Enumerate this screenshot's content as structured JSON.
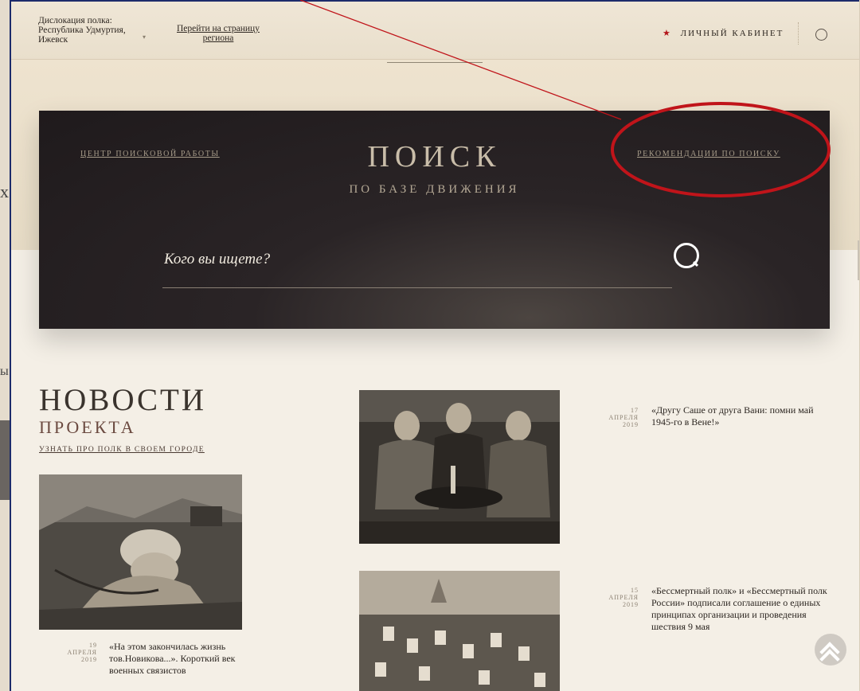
{
  "topbar": {
    "location_label": "Дислокация полка:",
    "location_region": "Республика Удмуртия,",
    "location_city": "Ижевск",
    "region_link_line1": "Перейти на страницу",
    "region_link_line2": "региона",
    "cabinet_label": "ЛИЧНЫЙ КАБИНЕТ"
  },
  "search_panel": {
    "left_link": "ЦЕНТР ПОИСКОВОЙ РАБОТЫ",
    "title": "ПОИСК",
    "subtitle": "ПО БАЗЕ ДВИЖЕНИЯ",
    "right_link": "РЕКОМЕНДАЦИИ ПО ПОИСКУ",
    "placeholder": "Кого вы ищете?"
  },
  "news": {
    "title": "НОВОСТИ",
    "subtitle": "ПРОЕКТА",
    "city_link": "УЗНАТЬ ПРО ПОЛК В СВОЕМ ГОРОДЕ",
    "items": [
      {
        "day": "19",
        "month": "АПРЕЛЯ",
        "year": "2019",
        "text": "«На этом закончилась жизнь тов.Новикова...». Короткий век военных связистов"
      },
      {
        "day": "17",
        "month": "АПРЕЛЯ",
        "year": "2019",
        "text": "«Другу Саше от друга Вани: помни май 1945-го в Вене!»"
      },
      {
        "day": "15",
        "month": "АПРЕЛЯ",
        "year": "2019",
        "text": "«Бессмертный полк» и «Бессмертный полк России» подписали соглашение о единых принципах организации и проведения шествия 9 мая"
      }
    ]
  },
  "annotation": {
    "color": "#c0141a"
  },
  "icons": [
    "star-icon",
    "search-icon",
    "scroll-top-icon"
  ]
}
